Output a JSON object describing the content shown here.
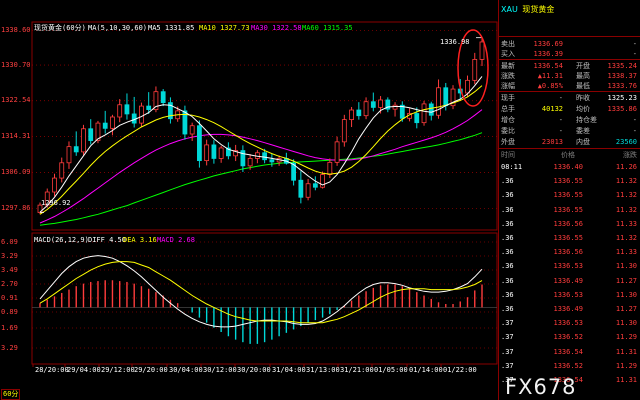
{
  "main_header": {
    "period_name": "现货黄金(60分)",
    "ma_label": "MA(5,10,30,60)",
    "ma5": "MA5 1331.85",
    "ma10": "MA10 1327.73",
    "ma30": "MA30 1322.58",
    "ma60": "MA60 1315.35"
  },
  "macd_header": {
    "params": "MACD(26,12,9)",
    "diff": "DIFF 4.50",
    "dea": "DEA 3.16",
    "macd": "MACD 2.68"
  },
  "period_badge": "60分",
  "price_axis": [
    "1338.60",
    "1330.70",
    "1322.54",
    "1314.31",
    "1306.09",
    "1297.86"
  ],
  "macd_axis": [
    "6.09",
    "3.29",
    "3.49",
    "2.70",
    "0.91",
    "0.89",
    "1.69",
    "3.29"
  ],
  "time_axis": [
    "28/20:00",
    "29/04:00",
    "29/12:00",
    "29/20:00",
    "30/04:00",
    "30/12:00",
    "30/20:00",
    "31/04:00",
    "31/13:00",
    "31/21:00",
    "01/05:00",
    "01/14:00",
    "01/22:00"
  ],
  "annotations": {
    "high": "1336.98",
    "low": "1296.92"
  },
  "colors": {
    "up": "#ff3c3c",
    "down": "#00d8d8",
    "ma5": "#ffffff",
    "ma10": "#ffff00",
    "ma30": "#ff00ff",
    "ma60": "#00ff00",
    "circle": "#ff2020",
    "grid": "#8a0000",
    "label_yellow": "#ffff00",
    "label_cyan": "#00ffff"
  },
  "chart_data": {
    "type": "candlestick",
    "ylim": [
      1294.5,
      1339.2
    ],
    "candles": [
      {
        "o": 1296.9,
        "h": 1299.2,
        "l": 1296.5,
        "c": 1298.6
      },
      {
        "o": 1298.6,
        "h": 1302.4,
        "l": 1298.0,
        "c": 1301.6
      },
      {
        "o": 1301.6,
        "h": 1305.8,
        "l": 1300.6,
        "c": 1304.8
      },
      {
        "o": 1304.8,
        "h": 1309.5,
        "l": 1303.8,
        "c": 1308.3
      },
      {
        "o": 1308.3,
        "h": 1313.2,
        "l": 1306.9,
        "c": 1312.0
      },
      {
        "o": 1312.0,
        "h": 1315.5,
        "l": 1309.9,
        "c": 1310.8
      },
      {
        "o": 1310.8,
        "h": 1317.0,
        "l": 1310.0,
        "c": 1316.1
      },
      {
        "o": 1316.1,
        "h": 1318.3,
        "l": 1312.5,
        "c": 1313.4
      },
      {
        "o": 1313.4,
        "h": 1317.9,
        "l": 1312.8,
        "c": 1317.4
      },
      {
        "o": 1317.4,
        "h": 1320.2,
        "l": 1315.0,
        "c": 1316.2
      },
      {
        "o": 1316.2,
        "h": 1319.3,
        "l": 1314.6,
        "c": 1318.8
      },
      {
        "o": 1318.8,
        "h": 1322.9,
        "l": 1317.6,
        "c": 1321.6
      },
      {
        "o": 1321.6,
        "h": 1324.2,
        "l": 1318.2,
        "c": 1319.5
      },
      {
        "o": 1319.5,
        "h": 1323.4,
        "l": 1316.4,
        "c": 1317.4
      },
      {
        "o": 1317.4,
        "h": 1322.1,
        "l": 1316.5,
        "c": 1321.3
      },
      {
        "o": 1321.3,
        "h": 1324.5,
        "l": 1319.5,
        "c": 1320.5
      },
      {
        "o": 1320.5,
        "h": 1325.8,
        "l": 1319.9,
        "c": 1324.6
      },
      {
        "o": 1324.6,
        "h": 1325.2,
        "l": 1321.3,
        "c": 1322.1
      },
      {
        "o": 1322.1,
        "h": 1323.3,
        "l": 1317.3,
        "c": 1318.4
      },
      {
        "o": 1318.4,
        "h": 1321.2,
        "l": 1317.7,
        "c": 1320.2
      },
      {
        "o": 1320.2,
        "h": 1321.4,
        "l": 1313.6,
        "c": 1314.9
      },
      {
        "o": 1314.9,
        "h": 1317.5,
        "l": 1313.3,
        "c": 1316.8
      },
      {
        "o": 1316.8,
        "h": 1318.0,
        "l": 1307.2,
        "c": 1308.8
      },
      {
        "o": 1308.8,
        "h": 1313.6,
        "l": 1307.7,
        "c": 1312.4
      },
      {
        "o": 1312.4,
        "h": 1313.5,
        "l": 1308.1,
        "c": 1309.3
      },
      {
        "o": 1309.3,
        "h": 1312.2,
        "l": 1308.3,
        "c": 1311.7
      },
      {
        "o": 1311.7,
        "h": 1313.0,
        "l": 1309.1,
        "c": 1309.9
      },
      {
        "o": 1309.9,
        "h": 1312.4,
        "l": 1308.7,
        "c": 1311.1
      },
      {
        "o": 1311.1,
        "h": 1312.3,
        "l": 1306.2,
        "c": 1307.6
      },
      {
        "o": 1307.6,
        "h": 1310.3,
        "l": 1306.7,
        "c": 1309.3
      },
      {
        "o": 1309.3,
        "h": 1311.2,
        "l": 1308.2,
        "c": 1310.6
      },
      {
        "o": 1310.6,
        "h": 1311.5,
        "l": 1308.2,
        "c": 1309.0
      },
      {
        "o": 1309.0,
        "h": 1310.4,
        "l": 1307.4,
        "c": 1308.5
      },
      {
        "o": 1308.5,
        "h": 1310.0,
        "l": 1307.6,
        "c": 1309.3
      },
      {
        "o": 1309.3,
        "h": 1310.6,
        "l": 1307.9,
        "c": 1308.2
      },
      {
        "o": 1308.2,
        "h": 1309.1,
        "l": 1303.1,
        "c": 1304.3
      },
      {
        "o": 1304.3,
        "h": 1306.4,
        "l": 1299.0,
        "c": 1300.4
      },
      {
        "o": 1300.4,
        "h": 1304.6,
        "l": 1299.7,
        "c": 1303.5
      },
      {
        "o": 1303.5,
        "h": 1305.2,
        "l": 1302.0,
        "c": 1302.7
      },
      {
        "o": 1302.7,
        "h": 1306.3,
        "l": 1302.4,
        "c": 1305.6
      },
      {
        "o": 1305.6,
        "h": 1309.3,
        "l": 1304.8,
        "c": 1308.4
      },
      {
        "o": 1308.4,
        "h": 1314.3,
        "l": 1307.6,
        "c": 1313.1
      },
      {
        "o": 1313.1,
        "h": 1319.3,
        "l": 1312.0,
        "c": 1318.2
      },
      {
        "o": 1318.2,
        "h": 1321.1,
        "l": 1316.5,
        "c": 1320.4
      },
      {
        "o": 1320.4,
        "h": 1322.2,
        "l": 1318.2,
        "c": 1319.1
      },
      {
        "o": 1319.1,
        "h": 1323.3,
        "l": 1318.3,
        "c": 1322.3
      },
      {
        "o": 1322.3,
        "h": 1324.4,
        "l": 1320.1,
        "c": 1321.0
      },
      {
        "o": 1321.0,
        "h": 1323.6,
        "l": 1319.6,
        "c": 1322.7
      },
      {
        "o": 1322.7,
        "h": 1323.3,
        "l": 1319.9,
        "c": 1320.6
      },
      {
        "o": 1320.6,
        "h": 1322.2,
        "l": 1318.9,
        "c": 1321.5
      },
      {
        "o": 1321.5,
        "h": 1322.4,
        "l": 1317.7,
        "c": 1318.5
      },
      {
        "o": 1318.5,
        "h": 1320.8,
        "l": 1317.8,
        "c": 1319.6
      },
      {
        "o": 1319.6,
        "h": 1321.0,
        "l": 1316.2,
        "c": 1317.5
      },
      {
        "o": 1317.5,
        "h": 1322.5,
        "l": 1316.8,
        "c": 1321.8
      },
      {
        "o": 1321.8,
        "h": 1322.3,
        "l": 1318.0,
        "c": 1319.2
      },
      {
        "o": 1319.2,
        "h": 1327.4,
        "l": 1318.4,
        "c": 1325.5
      },
      {
        "o": 1325.5,
        "h": 1326.6,
        "l": 1320.3,
        "c": 1321.4
      },
      {
        "o": 1321.4,
        "h": 1326.1,
        "l": 1320.6,
        "c": 1325.2
      },
      {
        "o": 1325.2,
        "h": 1327.5,
        "l": 1322.6,
        "c": 1324.3
      },
      {
        "o": 1324.3,
        "h": 1328.3,
        "l": 1323.4,
        "c": 1327.2
      },
      {
        "o": 1327.2,
        "h": 1333.5,
        "l": 1326.3,
        "c": 1332.0
      },
      {
        "o": 1332.0,
        "h": 1336.98,
        "l": 1330.5,
        "c": 1336.0
      }
    ],
    "ma5": [
      1297.0,
      1298.5,
      1300.4,
      1302.7,
      1305.3,
      1307.6,
      1309.9,
      1312.2,
      1313.8,
      1314.7,
      1315.7,
      1316.9,
      1317.6,
      1318.2,
      1318.9,
      1319.8,
      1321.2,
      1321.6,
      1321.5,
      1320.7,
      1319.9,
      1318.9,
      1317.3,
      1315.6,
      1313.8,
      1312.5,
      1311.4,
      1310.9,
      1310.4,
      1310.1,
      1309.8,
      1309.6,
      1309.3,
      1309.0,
      1308.7,
      1307.9,
      1306.6,
      1305.3,
      1304.1,
      1303.2,
      1303.9,
      1305.6,
      1308.1,
      1310.8,
      1313.8,
      1316.3,
      1318.6,
      1320.3,
      1321.1,
      1321.2,
      1321.2,
      1320.9,
      1320.5,
      1320.1,
      1319.9,
      1320.5,
      1321.4,
      1322.2,
      1322.9,
      1324.1,
      1326.0,
      1328.1
    ],
    "ma10": [
      1296.5,
      1297.6,
      1299.0,
      1300.6,
      1302.4,
      1304.1,
      1305.9,
      1307.7,
      1309.4,
      1310.9,
      1312.2,
      1313.4,
      1314.5,
      1315.5,
      1316.5,
      1317.3,
      1318.1,
      1318.7,
      1319.1,
      1319.3,
      1319.4,
      1319.2,
      1318.8,
      1318.2,
      1317.5,
      1316.6,
      1315.6,
      1314.6,
      1313.6,
      1312.7,
      1311.9,
      1311.1,
      1310.4,
      1309.8,
      1309.3,
      1308.7,
      1307.9,
      1307.1,
      1306.4,
      1305.9,
      1305.7,
      1305.9,
      1306.4,
      1307.3,
      1308.6,
      1310.2,
      1312.0,
      1313.9,
      1315.6,
      1317.0,
      1318.3,
      1319.3,
      1320.0,
      1320.5,
      1320.8,
      1321.1,
      1321.5,
      1322.0,
      1322.6,
      1323.4,
      1324.6,
      1326.0
    ],
    "ma30": [
      1294.5,
      1295.2,
      1296.0,
      1296.9,
      1297.9,
      1299.0,
      1300.1,
      1301.3,
      1302.5,
      1303.7,
      1304.9,
      1306.1,
      1307.2,
      1308.3,
      1309.3,
      1310.3,
      1311.2,
      1312.0,
      1312.7,
      1313.3,
      1313.8,
      1314.2,
      1314.5,
      1314.7,
      1314.8,
      1314.8,
      1314.7,
      1314.5,
      1314.2,
      1313.8,
      1313.4,
      1312.9,
      1312.4,
      1311.9,
      1311.4,
      1310.9,
      1310.4,
      1309.9,
      1309.5,
      1309.2,
      1309.0,
      1308.9,
      1308.9,
      1309.0,
      1309.2,
      1309.5,
      1309.9,
      1310.4,
      1310.9,
      1311.4,
      1312.0,
      1312.5,
      1313.0,
      1313.5,
      1314.0,
      1314.6,
      1315.3,
      1316.1,
      1317.0,
      1318.0,
      1319.2,
      1320.5
    ],
    "ma60": [
      1294.0,
      1294.2,
      1294.4,
      1294.7,
      1295.0,
      1295.3,
      1295.7,
      1296.1,
      1296.5,
      1297.0,
      1297.5,
      1298.0,
      1298.5,
      1299.1,
      1299.7,
      1300.3,
      1300.9,
      1301.5,
      1302.1,
      1302.7,
      1303.3,
      1303.8,
      1304.3,
      1304.8,
      1305.3,
      1305.7,
      1306.1,
      1306.5,
      1306.9,
      1307.2,
      1307.5,
      1307.8,
      1308.0,
      1308.2,
      1308.3,
      1308.4,
      1308.5,
      1308.6,
      1308.7,
      1308.8,
      1308.9,
      1309.0,
      1309.1,
      1309.2,
      1309.4,
      1309.6,
      1309.8,
      1310.0,
      1310.3,
      1310.6,
      1310.9,
      1311.2,
      1311.5,
      1311.8,
      1312.1,
      1312.4,
      1312.8,
      1313.2,
      1313.6,
      1314.1,
      1314.6,
      1315.2
    ],
    "macd_ylim": [
      -6.2,
      7.0
    ],
    "macd_hist": [
      0.5,
      0.9,
      1.3,
      1.7,
      2.1,
      2.5,
      2.8,
      3.0,
      3.1,
      3.2,
      3.2,
      3.1,
      3.0,
      2.8,
      2.5,
      2.2,
      1.8,
      1.4,
      0.9,
      0.5,
      0.0,
      -0.6,
      -1.2,
      -1.8,
      -2.4,
      -2.9,
      -3.4,
      -3.8,
      -4.1,
      -4.3,
      -4.3,
      -4.1,
      -3.8,
      -3.4,
      -3.0,
      -2.6,
      -2.2,
      -1.8,
      -1.5,
      -1.2,
      -0.8,
      -0.3,
      0.2,
      0.8,
      1.4,
      1.9,
      2.3,
      2.6,
      2.7,
      2.7,
      2.5,
      2.2,
      1.8,
      1.4,
      1.0,
      0.6,
      0.4,
      0.4,
      0.7,
      1.2,
      2.0,
      2.7
    ],
    "macd_diff": [
      1.0,
      2.0,
      3.0,
      4.0,
      4.8,
      5.4,
      5.8,
      6.0,
      6.1,
      6.0,
      5.8,
      5.4,
      4.9,
      4.3,
      3.6,
      2.8,
      2.0,
      1.2,
      0.5,
      -0.2,
      -0.8,
      -1.3,
      -1.7,
      -2.0,
      -2.2,
      -2.3,
      -2.3,
      -2.2,
      -2.0,
      -1.8,
      -1.6,
      -1.5,
      -1.5,
      -1.6,
      -1.7,
      -1.9,
      -2.0,
      -2.0,
      -1.9,
      -1.6,
      -1.1,
      -0.5,
      0.2,
      1.0,
      1.7,
      2.3,
      2.7,
      2.9,
      2.9,
      2.8,
      2.6,
      2.3,
      2.1,
      1.9,
      1.8,
      1.8,
      1.9,
      2.1,
      2.4,
      2.8,
      3.6,
      4.5
    ],
    "macd_dea": [
      0.5,
      1.0,
      1.6,
      2.2,
      2.8,
      3.4,
      3.9,
      4.4,
      4.8,
      5.1,
      5.3,
      5.4,
      5.4,
      5.3,
      5.0,
      4.7,
      4.2,
      3.7,
      3.2,
      2.6,
      2.0,
      1.4,
      0.9,
      0.4,
      0.0,
      -0.4,
      -0.8,
      -1.1,
      -1.3,
      -1.5,
      -1.6,
      -1.6,
      -1.6,
      -1.6,
      -1.6,
      -1.7,
      -1.8,
      -1.8,
      -1.8,
      -1.8,
      -1.6,
      -1.4,
      -1.1,
      -0.7,
      -0.3,
      0.2,
      0.7,
      1.2,
      1.6,
      1.9,
      2.1,
      2.2,
      2.2,
      2.2,
      2.1,
      2.1,
      2.1,
      2.1,
      2.2,
      2.4,
      2.7,
      3.16
    ]
  },
  "quote": {
    "title_code": "XAU",
    "title_name": "现货黄金",
    "rows": [
      {
        "l": "卖出",
        "v": "1336.69",
        "r": "",
        "rv": "-",
        "vc": "#ff3c3c",
        "rvc": "#c0c0c0"
      },
      {
        "l": "买入",
        "v": "1336.39",
        "r": "",
        "rv": "-",
        "vc": "#ff3c3c",
        "rvc": "#c0c0c0"
      },
      {
        "l": "最新",
        "v": "1336.54",
        "r": "开盘",
        "rv": "1335.24",
        "vc": "#ff3c3c",
        "rvc": "#ff3c3c"
      },
      {
        "l": "涨跌",
        "v": "▲11.31",
        "r": "最高",
        "rv": "1338.37",
        "vc": "#ff3c3c",
        "rvc": "#ff3c3c"
      },
      {
        "l": "涨幅",
        "v": "▲0.85%",
        "r": "最低",
        "rv": "1333.76",
        "vc": "#ff3c3c",
        "rvc": "#ff3c3c"
      },
      {
        "l": "现手",
        "v": "-",
        "r": "昨收",
        "rv": "1325.23",
        "vc": "#c0c0c0",
        "rvc": "#ffffff"
      },
      {
        "l": "总手",
        "v": "40132",
        "r": "均价",
        "rv": "1335.86",
        "vc": "#ffff00",
        "rvc": "#ff3c3c"
      },
      {
        "l": "增仓",
        "v": "-",
        "r": "持仓差",
        "rv": "-",
        "vc": "#c0c0c0",
        "rvc": "#c0c0c0"
      },
      {
        "l": "委比",
        "v": "-",
        "r": "委差",
        "rv": "-",
        "vc": "#c0c0c0",
        "rvc": "#c0c0c0"
      },
      {
        "l": "外盘",
        "v": "23013",
        "r": "内盘",
        "rv": "23560",
        "vc": "#ff3c3c",
        "rvc": "#00d8d8"
      }
    ],
    "tick_headers": {
      "time": "时间",
      "price": "价格",
      "change": "涨跌"
    },
    "ticks": [
      {
        "t": "08:11",
        "p": "1336.40",
        "c": "11.26"
      },
      {
        "t": ".36",
        "p": "1336.55",
        "c": "11.32"
      },
      {
        "t": ".36",
        "p": "1336.55",
        "c": "11.32"
      },
      {
        "t": ".36",
        "p": "1336.55",
        "c": "11.32"
      },
      {
        "t": ".36",
        "p": "1336.56",
        "c": "11.33"
      },
      {
        "t": ".36",
        "p": "1336.55",
        "c": "11.32"
      },
      {
        "t": ".36",
        "p": "1336.56",
        "c": "11.33"
      },
      {
        "t": ".36",
        "p": "1336.53",
        "c": "11.30"
      },
      {
        "t": ".36",
        "p": "1336.49",
        "c": "11.27"
      },
      {
        "t": ".36",
        "p": "1336.53",
        "c": "11.30"
      },
      {
        "t": ".36",
        "p": "1336.49",
        "c": "11.27"
      },
      {
        "t": ".37",
        "p": "1336.53",
        "c": "11.30"
      },
      {
        "t": ".37",
        "p": "1336.52",
        "c": "11.29"
      },
      {
        "t": ".37",
        "p": "1336.54",
        "c": "11.31"
      },
      {
        "t": ".37",
        "p": "1336.52",
        "c": "11.29"
      },
      {
        "t": ".37",
        "p": "1336.54",
        "c": "11.31"
      }
    ]
  },
  "watermark": "FX678"
}
